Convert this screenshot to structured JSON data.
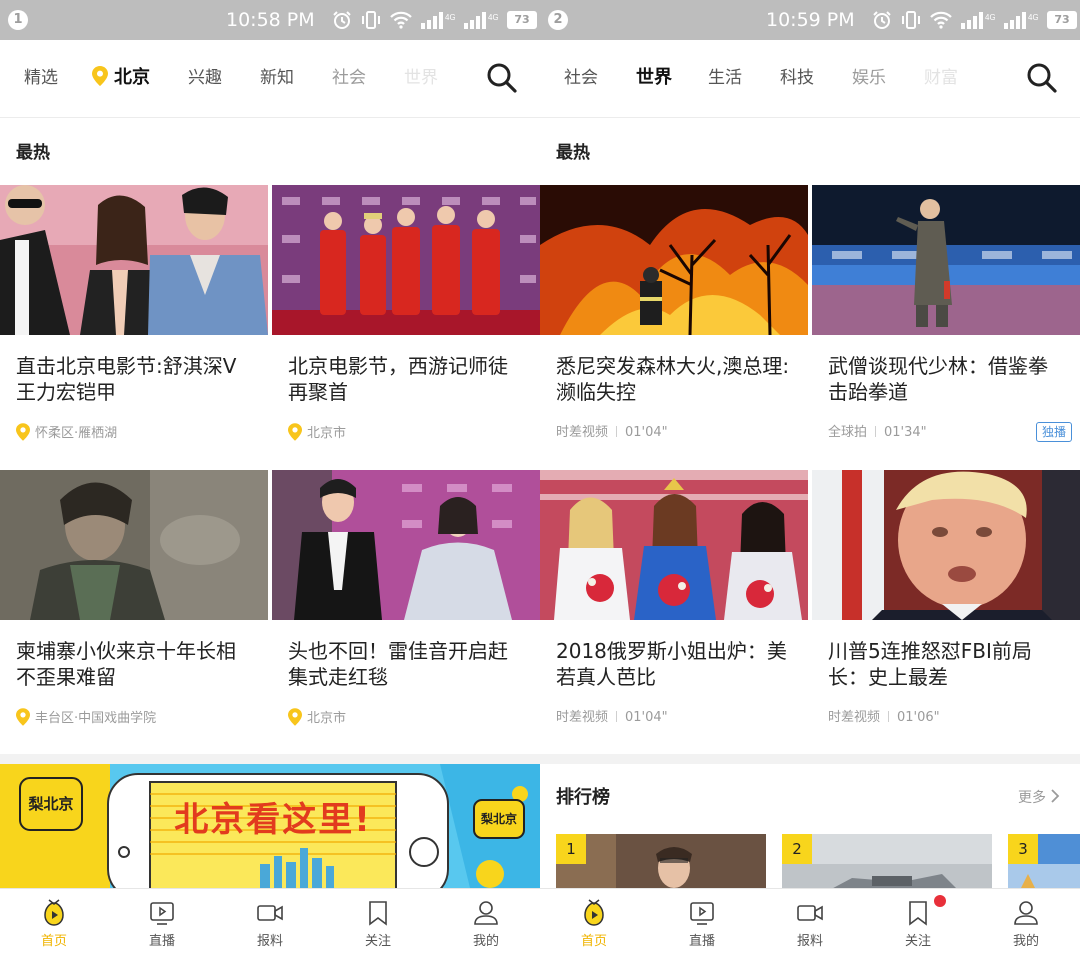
{
  "panels": [
    {
      "index": "1",
      "status": {
        "time": "10:58 PM",
        "battery": "73"
      },
      "tabs": [
        "精选",
        "北京",
        "兴趣",
        "新知",
        "社会",
        "世界"
      ],
      "section_title": "最热",
      "cards": [
        {
          "title": "直击北京电影节:舒淇深V王力宏铠甲",
          "location": "怀柔区·雁栖湖",
          "image": "film-festival-red-carpet-stars"
        },
        {
          "title": "北京电影节，西游记师徒再聚首",
          "location": "北京市",
          "image": "journey-to-the-west-cast-red-costumes"
        },
        {
          "title": "柬埔寨小伙来京十年长相不歪果难留",
          "location": "丰台区·中国戏曲学院",
          "image": "young-man-portrait-sepia"
        },
        {
          "title": "头也不回！雷佳音开启赶集式走红毯",
          "location": "北京市",
          "image": "actor-and-actress-red-carpet"
        }
      ],
      "banner": {
        "logo_text": "梨北京",
        "headline": "北京看这里!",
        "badge_text": "梨北京"
      }
    },
    {
      "index": "2",
      "status": {
        "time": "10:59 PM",
        "battery": "73"
      },
      "tabs": [
        "社会",
        "世界",
        "生活",
        "科技",
        "娱乐",
        "财富"
      ],
      "section_title": "最热",
      "cards": [
        {
          "title": "悉尼突发森林大火,澳总理:濒临失控",
          "source": "时差视频",
          "duration": "01'04\"",
          "image": "bushfire-firefighter-night"
        },
        {
          "title": "武僧谈现代少林：借鉴拳击跆拳道",
          "source": "全球拍",
          "duration": "01'34\"",
          "badge": "独播",
          "image": "shaolin-monk-on-mat"
        },
        {
          "title": "2018俄罗斯小姐出炉：美若真人芭比",
          "source": "时差视频",
          "duration": "01'04\"",
          "image": "beauty-pageant-winners-flowers"
        },
        {
          "title": "川普5连推怒怼FBI前局长：史上最差",
          "source": "时差视频",
          "duration": "01'06\"",
          "image": "politician-close-up"
        }
      ],
      "ranking": {
        "title": "排行榜",
        "more": "更多",
        "items": [
          "1",
          "2",
          "3"
        ]
      }
    }
  ],
  "bottom_nav": [
    {
      "label": "首页",
      "icon": "home-play-icon",
      "active": true
    },
    {
      "label": "直播",
      "icon": "live-screen-icon"
    },
    {
      "label": "报料",
      "icon": "video-camera-icon"
    },
    {
      "label": "关注",
      "icon": "bookmark-icon"
    },
    {
      "label": "我的",
      "icon": "person-icon"
    }
  ],
  "colors": {
    "accent": "#f8d51c",
    "badge_blue": "#4a90d9",
    "notify_red": "#e8303a"
  }
}
